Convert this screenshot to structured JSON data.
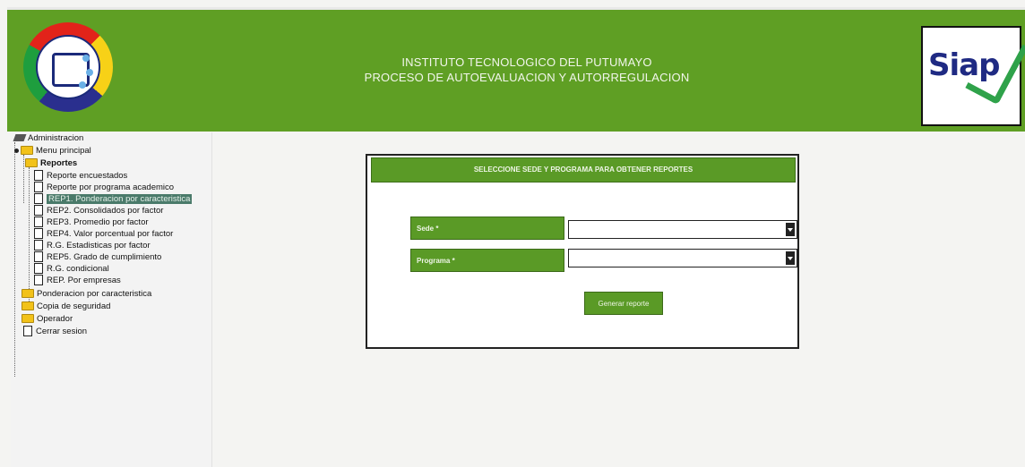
{
  "header": {
    "line1": "INSTITUTO TECNOLOGICO DEL PUTUMAYO",
    "line2": "PROCESO DE AUTOEVALUACION Y AUTORREGULACION",
    "right_logo_text": "Siap",
    "left_logo_colors": [
      "#e2231a",
      "#f7d117",
      "#2a2f8e",
      "#1e9e3e"
    ],
    "brand_green": "#5f9f24"
  },
  "tree": {
    "root": "Administracion",
    "menu_principal": "Menu principal",
    "reportes": "Reportes",
    "report_items": [
      "Reporte encuestados",
      "Reporte por programa academico",
      "REP1. Ponderacion por caracteristica",
      "REP2. Consolidados por factor",
      "REP3. Promedio por factor",
      "REP4. Valor porcentual por factor",
      "R.G. Estadisticas por factor",
      "REP5. Grado de cumplimiento",
      "R.G. condicional",
      "REP. Por empresas"
    ],
    "selected_index": 2,
    "ponderacion": "Ponderacion por caracteristica",
    "copia": "Copia de seguridad",
    "operador": "Operador",
    "cerrar": "Cerrar sesion"
  },
  "form": {
    "title": "SELECCIONE SEDE Y PROGRAMA PARA OBTENER REPORTES",
    "sede_label": "Sede *",
    "sede_value": "",
    "programa_label": "Programa *",
    "programa_value": "",
    "button": "Generar reporte"
  }
}
